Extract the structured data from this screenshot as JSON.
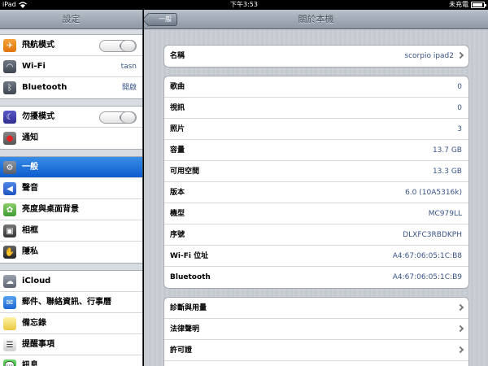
{
  "status": {
    "device": "iPad",
    "time": "下午3:53",
    "charge": "未充電"
  },
  "sidebar": {
    "title": "設定",
    "groups": [
      [
        {
          "label": "飛航模式",
          "icon": "airplane-icon",
          "type": "toggle"
        },
        {
          "label": "Wi-Fi",
          "icon": "wifi-icon",
          "value": "tasn"
        },
        {
          "label": "Bluetooth",
          "icon": "bluetooth-icon",
          "value": "開啟"
        }
      ],
      [
        {
          "label": "勿擾模式",
          "icon": "moon-icon",
          "type": "toggle"
        },
        {
          "label": "通知",
          "icon": "notifications-icon"
        }
      ],
      [
        {
          "label": "一般",
          "icon": "gear-icon",
          "selected": true
        },
        {
          "label": "聲音",
          "icon": "speaker-icon"
        },
        {
          "label": "亮度與桌面背景",
          "icon": "brightness-icon"
        },
        {
          "label": "相框",
          "icon": "picture-frame-icon"
        },
        {
          "label": "隱私",
          "icon": "privacy-hand-icon"
        }
      ],
      [
        {
          "label": "iCloud",
          "icon": "cloud-icon"
        },
        {
          "label": "郵件、聯絡資訊、行事曆",
          "icon": "mail-icon"
        },
        {
          "label": "備忘錄",
          "icon": "notes-icon"
        },
        {
          "label": "提醒事項",
          "icon": "reminders-icon"
        },
        {
          "label": "訊息",
          "icon": "messages-icon"
        }
      ]
    ]
  },
  "main": {
    "back_label": "一般",
    "title": "關於本機",
    "name_row": {
      "key": "名稱",
      "value": "scorpio ipad2"
    },
    "info_rows": [
      {
        "key": "歌曲",
        "value": "0"
      },
      {
        "key": "視訊",
        "value": "0"
      },
      {
        "key": "照片",
        "value": "3"
      },
      {
        "key": "容量",
        "value": "13.7 GB"
      },
      {
        "key": "可用空間",
        "value": "13.3 GB"
      },
      {
        "key": "版本",
        "value": "6.0 (10A5316k)"
      },
      {
        "key": "機型",
        "value": "MC979LL"
      },
      {
        "key": "序號",
        "value": "DLXFC3RBDKPH"
      },
      {
        "key": "Wi-Fi 位址",
        "value": "A4:67:06:05:1C:B8"
      },
      {
        "key": "Bluetooth",
        "value": "A4:67:06:05:1C:B9"
      }
    ],
    "link_rows": [
      {
        "key": "診斷與用量"
      },
      {
        "key": "法律聲明"
      },
      {
        "key": "許可證"
      },
      {
        "key": ""
      }
    ]
  }
}
